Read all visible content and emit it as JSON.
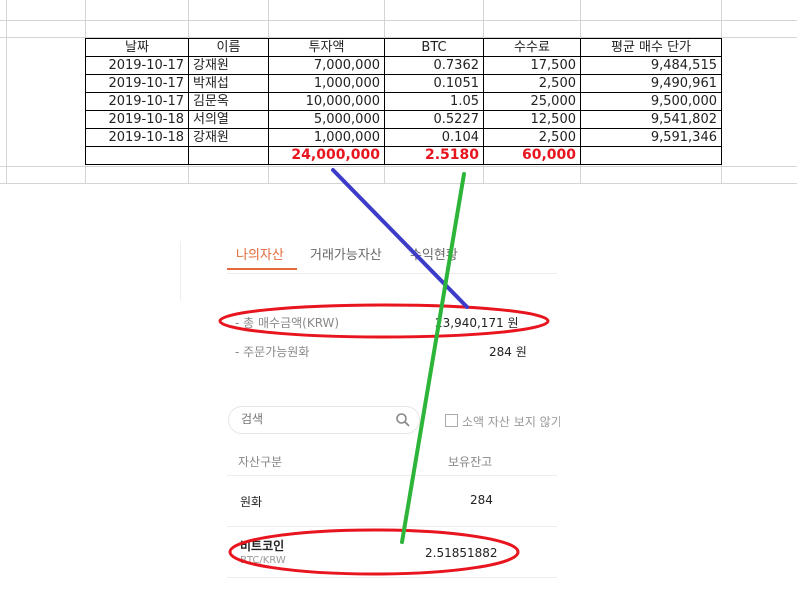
{
  "sheet": {
    "headers": [
      "날짜",
      "이름",
      "투자액",
      "BTC",
      "수수료",
      "평균 매수 단가"
    ],
    "rows": [
      [
        "2019-10-17",
        "강재원",
        "7,000,000",
        "0.7362",
        "17,500",
        "9,484,515"
      ],
      [
        "2019-10-17",
        "박재섭",
        "1,000,000",
        "0.1051",
        "2,500",
        "9,490,961"
      ],
      [
        "2019-10-17",
        "김문옥",
        "10,000,000",
        "1.05",
        "25,000",
        "9,500,000"
      ],
      [
        "2019-10-18",
        "서의열",
        "5,000,000",
        "0.5227",
        "12,500",
        "9,541,802"
      ],
      [
        "2019-10-18",
        "강재원",
        "1,000,000",
        "0.104",
        "2,500",
        "9,591,346"
      ]
    ],
    "totals": {
      "invest": "24,000,000",
      "btc": "2.5180",
      "fee": "60,000"
    }
  },
  "panel": {
    "tabs": [
      "나의자산",
      "거래가능자산",
      "수익현황"
    ],
    "total_buy_label": "- 총 매수금액(KRW)",
    "total_buy_value": "23,940,171 원",
    "orderable_label": "- 주문가능원화",
    "orderable_value": "284 원",
    "search_placeholder": "검색",
    "hide_small_label": "소액 자산 보지 않기",
    "col_asset": "자산구분",
    "col_balance": "보유잔고",
    "assets": [
      {
        "name": "원화",
        "sub": "",
        "balance": "284"
      },
      {
        "name": "비트코인",
        "sub": "BTC/KRW",
        "balance": "2.51851882"
      }
    ]
  },
  "colors": {
    "highlight_red": "#e8141e",
    "tab_accent": "#e36a3a",
    "arrow_blue": "#3c3cc8",
    "arrow_green": "#2db53a"
  },
  "icons": {
    "search": "search-icon",
    "checkbox": "checkbox-icon"
  }
}
